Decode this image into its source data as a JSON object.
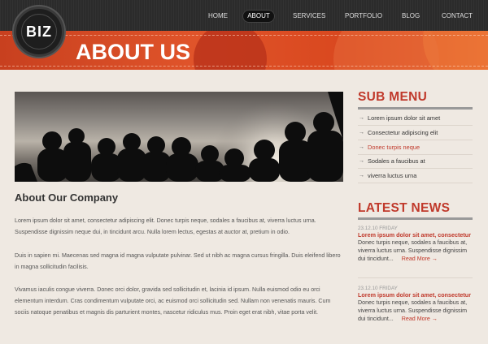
{
  "brand": {
    "logo_text": "BIZ"
  },
  "nav": {
    "items": [
      "HOME",
      "ABOUT",
      "SERVICES",
      "PORTFOLIO",
      "BLOG",
      "CONTACT"
    ],
    "active_index": 1
  },
  "header": {
    "title": "ABOUT US"
  },
  "main": {
    "heading": "About Our Company",
    "paragraphs": [
      "Lorem ipsum dolor sit amet, consectetur adipiscing elit. Donec turpis neque, sodales a faucibus at, viverra luctus urna. Suspendisse dignissim neque dui, in tincidunt arcu. Nulla lorem lectus, egestas at auctor at, pretium in odio.",
      "Duis in sapien mi. Maecenas sed magna id magna vulputate pulvinar. Sed ut nibh ac magna cursus fringilla. Duis eleifend libero in magna sollicitudin facilisis.",
      "Vivamus iaculis congue viverra. Donec orci dolor, gravida sed sollicitudin et, lacinia id ipsum. Nulla euismod odio eu orci elementum interdum. Cras condimentum vulputate orci, ac euismod orci sollicitudin sed. Nullam non venenatis mauris. Cum sociis natoque penatibus et magnis dis parturient montes, nascetur ridiculus mus. Proin eget erat nibh, vitae porta velit."
    ]
  },
  "sidebar": {
    "sub_menu_title": "SUB MENU",
    "sub_menu": [
      {
        "label": "Lorem ipsum dolor sit amet",
        "active": false
      },
      {
        "label": "Consectetur adipiscing elit",
        "active": false
      },
      {
        "label": "Donec turpis neque",
        "active": true
      },
      {
        "label": "Sodales a faucibus at",
        "active": false
      },
      {
        "label": "viverra luctus urna",
        "active": false
      }
    ],
    "arrow": "→",
    "news_title": "LATEST NEWS",
    "news": [
      {
        "date": "23.12.10 FRIDAY",
        "title": "Lorem ipsum dolor sit amet, consectetur",
        "body": "Donec turpis neque, sodales a faucibus at, viverra luctus urna. Suspendisse dignissim dui tincidunt...",
        "more": "Read More →"
      },
      {
        "date": "23.12.10 FRIDAY",
        "title": "Lorem ipsum dolor sit amet, consectetur",
        "body": "Donec turpis neque, sodales a faucibus at, viverra luctus urna. Suspendisse dignissim dui tincidunt...",
        "more": "Read More →"
      }
    ]
  },
  "colors": {
    "accent": "#c0392b",
    "topbar": "#2b2b2b",
    "banner": "#d9481f",
    "background": "#efe9e2"
  }
}
